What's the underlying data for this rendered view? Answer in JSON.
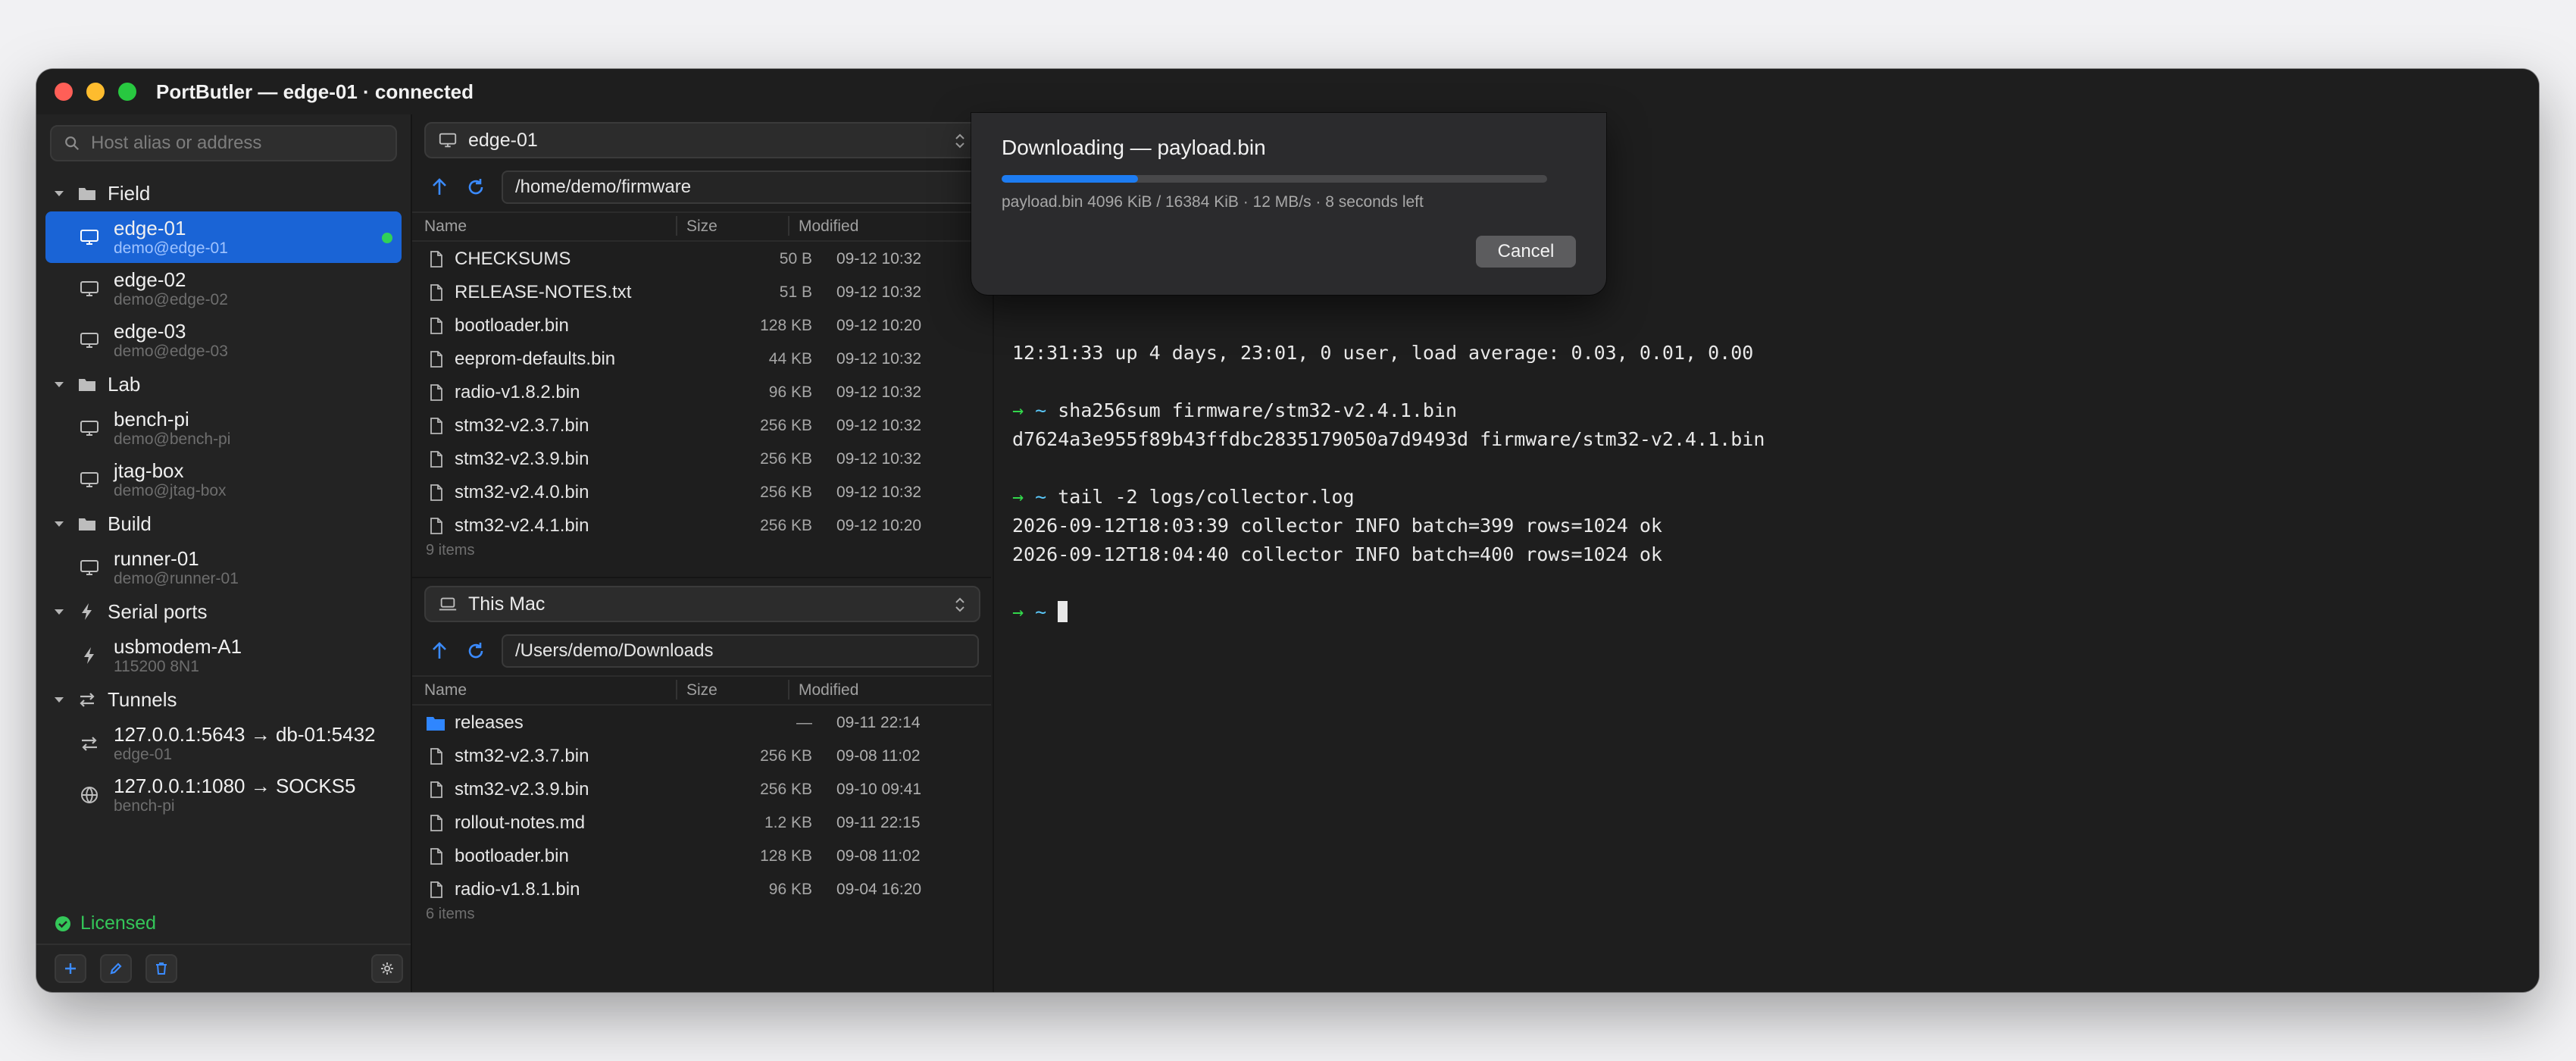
{
  "window": {
    "title": "PortButler — edge-01 · connected"
  },
  "sidebar": {
    "search_placeholder": "Host alias or address",
    "groups": {
      "field": {
        "label": "Field"
      },
      "lab": {
        "label": "Lab"
      },
      "build": {
        "label": "Build"
      },
      "serial": {
        "label": "Serial ports"
      },
      "tunnels": {
        "label": "Tunnels"
      }
    },
    "hosts": {
      "edge01": {
        "name": "edge-01",
        "sub": "demo@edge-01",
        "status": "connected"
      },
      "edge02": {
        "name": "edge-02",
        "sub": "demo@edge-02"
      },
      "edge03": {
        "name": "edge-03",
        "sub": "demo@edge-03"
      },
      "benchpi": {
        "name": "bench-pi",
        "sub": "demo@bench-pi"
      },
      "jtagbox": {
        "name": "jtag-box",
        "sub": "demo@jtag-box"
      },
      "runner01": {
        "name": "runner-01",
        "sub": "demo@runner-01"
      },
      "usbmodem": {
        "name": "usbmodem-A1",
        "sub": "115200 8N1"
      },
      "tunnel1": {
        "name": "127.0.0.1:5643 → db-01:5432",
        "sub": "edge-01"
      },
      "tunnel2": {
        "name": "127.0.0.1:1080 → SOCKS5",
        "sub": "bench-pi"
      }
    },
    "license": "Licensed"
  },
  "remote_pane": {
    "host": "edge-01",
    "path": "/home/demo/firmware",
    "columns": {
      "name": "Name",
      "size": "Size",
      "modified": "Modified"
    },
    "files": [
      {
        "name": "CHECKSUMS",
        "size": "50 B",
        "modified": "09-12 10:32"
      },
      {
        "name": "RELEASE-NOTES.txt",
        "size": "51 B",
        "modified": "09-12 10:32"
      },
      {
        "name": "bootloader.bin",
        "size": "128 KB",
        "modified": "09-12 10:20"
      },
      {
        "name": "eeprom-defaults.bin",
        "size": "44 KB",
        "modified": "09-12 10:32"
      },
      {
        "name": "radio-v1.8.2.bin",
        "size": "96 KB",
        "modified": "09-12 10:32"
      },
      {
        "name": "stm32-v2.3.7.bin",
        "size": "256 KB",
        "modified": "09-12 10:32"
      },
      {
        "name": "stm32-v2.3.9.bin",
        "size": "256 KB",
        "modified": "09-12 10:32"
      },
      {
        "name": "stm32-v2.4.0.bin",
        "size": "256 KB",
        "modified": "09-12 10:32"
      },
      {
        "name": "stm32-v2.4.1.bin",
        "size": "256 KB",
        "modified": "09-12 10:20"
      }
    ],
    "count": "9 items"
  },
  "local_pane": {
    "host": "This Mac",
    "path": "/Users/demo/Downloads",
    "columns": {
      "name": "Name",
      "size": "Size",
      "modified": "Modified"
    },
    "files": [
      {
        "name": "releases",
        "size": "—",
        "modified": "09-11 22:14",
        "type": "folder"
      },
      {
        "name": "stm32-v2.3.7.bin",
        "size": "256 KB",
        "modified": "09-08 11:02"
      },
      {
        "name": "stm32-v2.3.9.bin",
        "size": "256 KB",
        "modified": "09-10 09:41"
      },
      {
        "name": "rollout-notes.md",
        "size": "1.2 KB",
        "modified": "09-11 22:15"
      },
      {
        "name": "bootloader.bin",
        "size": "128 KB",
        "modified": "09-08 11:02"
      },
      {
        "name": "radio-v1.8.1.bin",
        "size": "96 KB",
        "modified": "09-04 16:20"
      }
    ],
    "count": "6 items"
  },
  "terminal": {
    "uptime": "12:31:33 up 4 days, 23:01, 0 user, load average: 0.03, 0.01, 0.00",
    "prompt_arrow": "→",
    "prompt_tilde": "~",
    "cmd1": "sha256sum firmware/stm32-v2.4.1.bin",
    "out1": "d7624a3e955f89b43ffdbc2835179050a7d9493d firmware/stm32-v2.4.1.bin",
    "cmd2": "tail -2 logs/collector.log",
    "out2a": "2026-09-12T18:03:39 collector INFO batch=399 rows=1024 ok",
    "out2b": "2026-09-12T18:04:40 collector INFO batch=400 rows=1024 ok"
  },
  "download": {
    "title": "Downloading — payload.bin",
    "progress": 0.25,
    "status": "payload.bin 4096 KiB / 16384 KiB · 12 MB/s · 8 seconds left",
    "cancel_label": "Cancel",
    "accent": "#1d7cf2"
  },
  "colors": {
    "accent": "#1a64d6",
    "connected": "#30d158",
    "licensed": "#34c759"
  }
}
